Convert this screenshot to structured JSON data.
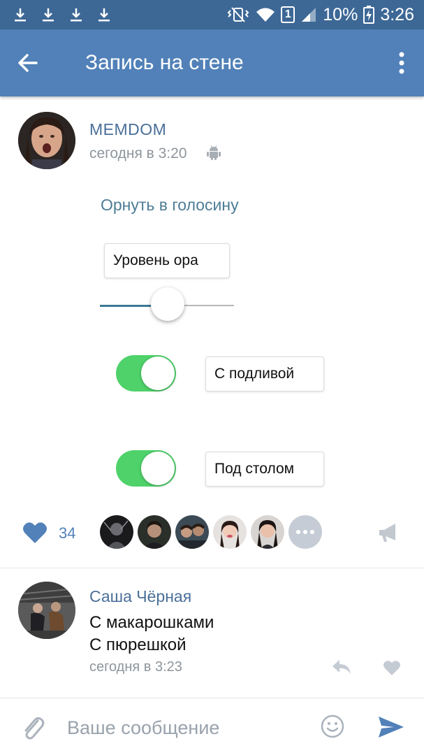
{
  "status_bar": {
    "battery": "10%",
    "time": "3:26",
    "sim": "1",
    "icons": [
      "download-icon",
      "download-icon",
      "download-icon",
      "download-icon",
      "vibrate-icon",
      "wifi-icon",
      "sim-icon",
      "signal-icon",
      "battery-charging-icon"
    ]
  },
  "app_bar": {
    "title": "Запись на стене",
    "back_icon": "arrow-left-icon",
    "menu_icon": "more-vertical-icon"
  },
  "post": {
    "author": "MEMDOM",
    "time": "сегодня в 3:20",
    "platform_icon": "android-icon",
    "image": {
      "link_text": "Орнуть в голосину",
      "level_label": "Уровень ора",
      "slider_value": 0.5,
      "toggle1_label": "С подливой",
      "toggle1_on": true,
      "toggle2_label": "Под столом",
      "toggle2_on": true
    }
  },
  "likes": {
    "count": "34",
    "liked": true,
    "liker_count": 5
  },
  "comment": {
    "author": "Саша Чёрная",
    "lines": [
      "С макарошками",
      "С пюрешкой"
    ],
    "time": "сегодня в 3:23"
  },
  "composer": {
    "placeholder": "Ваше сообщение"
  },
  "colors": {
    "status_bar": "#3d6896",
    "app_bar": "#5181b8",
    "link": "#4a6f99",
    "toggle_on": "#4fd26a"
  }
}
